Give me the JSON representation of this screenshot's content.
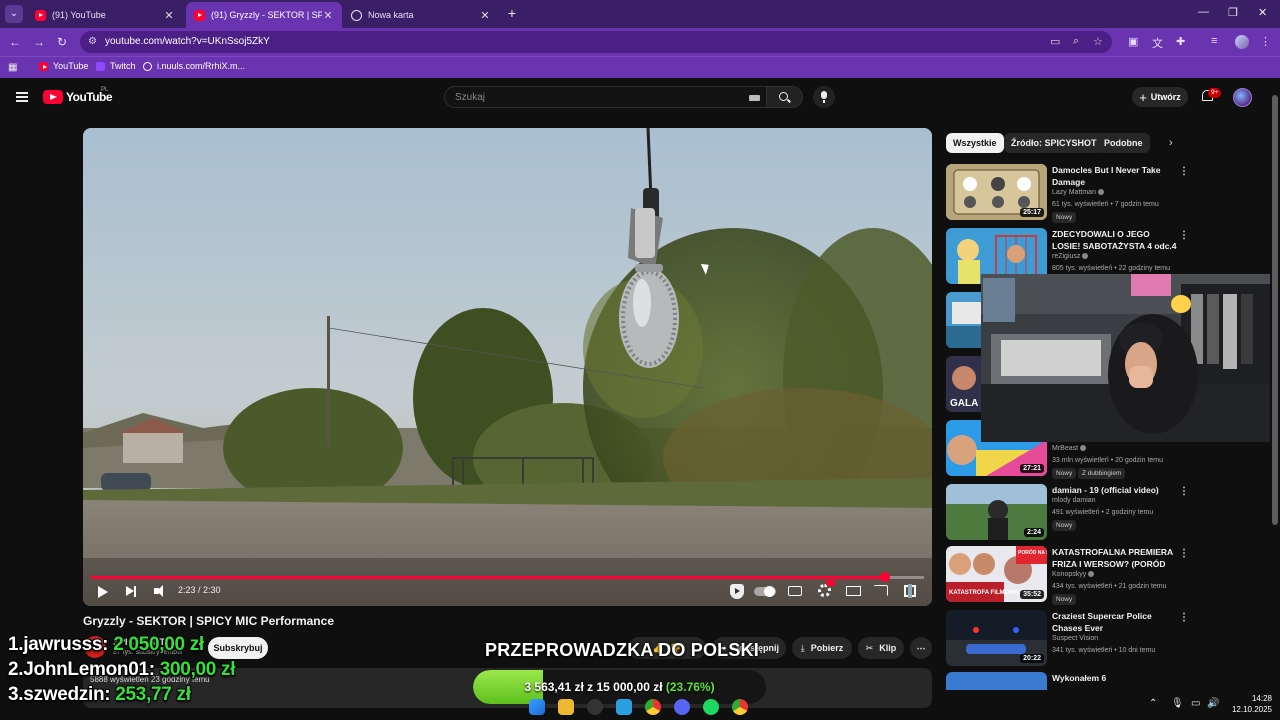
{
  "browser": {
    "tabs": [
      {
        "title": "(91) YouTube",
        "icon": "youtube-favicon-icon"
      },
      {
        "title": "(91) Gryzzly - SEKTOR | SPICY MIC",
        "icon": "youtube-favicon-icon",
        "active": true
      },
      {
        "title": "Nowa karta",
        "icon": "globe-icon"
      }
    ],
    "new_tab": "+",
    "window_controls": {
      "minimize": "—",
      "restore": "❐",
      "close": "✕"
    },
    "nav": {
      "back": "←",
      "forward": "→",
      "reload": "↻"
    },
    "url": "youtube.com/watch?v=UKnSsoj5ZkY",
    "bookmarks": [
      {
        "label": "YouTube",
        "icon": "youtube-favicon-icon"
      },
      {
        "label": "Twitch",
        "icon": "twitch-icon"
      },
      {
        "label": "i.nuuls.com/RrhiX.m...",
        "icon": "globe-icon"
      }
    ]
  },
  "youtube": {
    "logo_text": "YouTube",
    "logo_country": "PL",
    "search_placeholder": "Szukaj",
    "create_label": "Utwórz",
    "notifications_badge": "9+"
  },
  "player": {
    "time_display": "2:23 / 2:30",
    "progress": 0.953,
    "title": "Gryzzly - SEKTOR | SPICY MIC Performance"
  },
  "channel": {
    "name": "SPICYSHOT",
    "subscribers": "87 tys. subskrybentów",
    "subscribe_label": "Subskrybuj"
  },
  "actions": {
    "share_label": "Udostępnij",
    "download_label": "Pobierz",
    "clip_label": "Klip",
    "more": "⋯"
  },
  "description": {
    "meta": "5888 wyświetleń  23 godziny temu"
  },
  "sidebar": {
    "chips": [
      "Wszystkie",
      "Źródło: SPICYSHOT",
      "Podobne"
    ],
    "recommendations": [
      {
        "title": "Damocles But I Never Take Damage",
        "channel": "Lazy Mattman",
        "stats": "61 tys. wyświetleń • 7 godzin temu",
        "duration": "25:17",
        "badges": [
          "Nowy"
        ]
      },
      {
        "title": "ZDECYDOWALI O JEGO LOSIE! SABOTAŻYSTA 4 odc.4",
        "channel": "reZigiusz",
        "stats": "805 tys. wyświetleń • 22 godziny temu",
        "duration": "",
        "badges": []
      },
      {
        "title": "",
        "channel": "MrBeast",
        "stats": "33 mln wyświetleń • 20 godzin temu",
        "duration": "27:21",
        "badges": [
          "Nowy",
          "Z dubbingiem"
        ]
      },
      {
        "title": "damian - 19 (official video)",
        "channel": "mlody damian",
        "stats": "491 wyświetleń • 2 godziny temu",
        "duration": "2:24",
        "badges": [
          "Nowy"
        ]
      },
      {
        "title": "KATASTROFALNA PREMIERA FRIZA I WERSOW? (PORÓD N...",
        "channel": "Konopskyy",
        "stats": "434 tys. wyświetleń • 21 godzin temu",
        "duration": "35:52",
        "badges": [
          "Nowy"
        ]
      },
      {
        "title": "Craziest Supercar Police Chases Ever",
        "channel": "Suspect Vision",
        "stats": "341 tys. wyświetleń • 10 dni temu",
        "duration": "20:22",
        "badges": []
      },
      {
        "title": "Wykonałem 6",
        "channel": "",
        "stats": "",
        "duration": "",
        "badges": []
      }
    ],
    "thumb_texts": {
      "gala": "GALA R",
      "katastrofa": "KATASTROFA FILMOWA?",
      "porod": "PORÓD NA STREAMIE"
    }
  },
  "overlay": {
    "leaderboard": [
      {
        "rank": "1.",
        "name": "jawrusss:",
        "amount": "2 050,00 zł"
      },
      {
        "rank": "2.",
        "name": "JohnLemon01:",
        "amount": "300,00 zł"
      },
      {
        "rank": "3.",
        "name": "szwedzin:",
        "amount": "253,77 zł"
      }
    ],
    "banner": "PRZEPROWADZKA DO POLSKI",
    "goal": {
      "current": "3 563,41 zł",
      "separator": "z",
      "target": "15 000,00 zł",
      "percent": "(23.76%)",
      "fraction": 0.2376
    }
  },
  "system": {
    "time": "14:28",
    "date": "12.10.2025"
  }
}
